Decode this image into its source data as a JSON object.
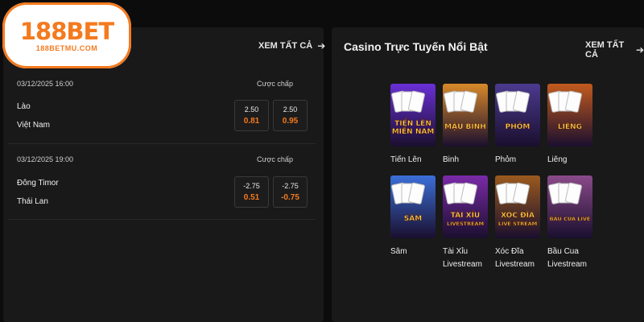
{
  "logo": {
    "main": "188BET",
    "sub": "188BETMU.COM"
  },
  "left_panel": {
    "see_all": "XEM TẤT CẢ",
    "matches": [
      {
        "date": "03/12/2025 16:00",
        "handicap_label": "Cược chấp",
        "home": "Lào",
        "away": "Việt Nam",
        "odds": [
          {
            "line": "2.50",
            "price": "0.81"
          },
          {
            "line": "2.50",
            "price": "0.95"
          }
        ]
      },
      {
        "date": "03/12/2025 19:00",
        "handicap_label": "Cược chấp",
        "home": "Đông Timor",
        "away": "Thái Lan",
        "odds": [
          {
            "line": "-2.75",
            "price": "0.51"
          },
          {
            "line": "-2.75",
            "price": "-0.75"
          }
        ]
      }
    ]
  },
  "right_panel": {
    "title": "Casino Trực Tuyến Nổi Bật",
    "see_all": "XEM TẤT CẢ",
    "games": [
      {
        "name": "Tiến Lên",
        "art_text": [
          "TIẾN LÊN",
          "MIỀN NAM"
        ],
        "color": "#6a2fd6"
      },
      {
        "name": "Binh",
        "art_text": [
          "MẬU BINH"
        ],
        "color": "#d8892a"
      },
      {
        "name": "Phỏm",
        "art_text": [
          "PHỎM"
        ],
        "color": "#4b3a8f"
      },
      {
        "name": "Liêng",
        "art_text": [
          "LIÊNG"
        ],
        "color": "#c25a1e"
      },
      {
        "name": "Sâm",
        "art_text": [
          "SÂM"
        ],
        "color": "#3b6fd8"
      },
      {
        "name": "Tài Xỉu Livestream",
        "art_text": [
          "TÀI XỈU",
          "LIVESTREAM"
        ],
        "color": "#7a2aa8"
      },
      {
        "name": "Xóc Đĩa Livestream",
        "art_text": [
          "XÓC ĐĨA",
          "LIVE STREAM"
        ],
        "color": "#9a5a1e"
      },
      {
        "name": "Bầu Cua Livestream",
        "art_text": [
          "BẦU CUA LIVE"
        ],
        "color": "#8a4a8a"
      }
    ]
  }
}
